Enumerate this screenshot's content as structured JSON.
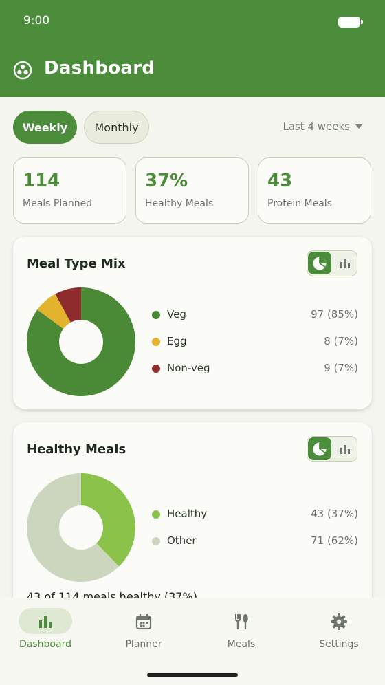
{
  "status_bar": {
    "time": "9:00"
  },
  "app": {
    "title": "Dashboard",
    "logo_icon": "three-dots-circle-icon"
  },
  "period_tabs": {
    "weekly": "Weekly",
    "monthly": "Monthly",
    "selected": "Weekly"
  },
  "range_select": {
    "label": "Last 4 weeks"
  },
  "stats": [
    {
      "value": "114",
      "label": "Meals Planned"
    },
    {
      "value": "37%",
      "label": "Healthy Meals"
    },
    {
      "value": "43",
      "label": "Protein Meals"
    }
  ],
  "colors": {
    "primary": "#4c8d3c",
    "veg": "#4a8a37",
    "egg": "#e3b32e",
    "non_veg": "#8e2b2c",
    "healthy": "#8bc34a",
    "other": "#ccd6bf"
  },
  "cards": {
    "meal_type": {
      "title": "Meal Type Mix",
      "view_toggle": {
        "pie_icon": "pie-chart-icon",
        "bar_icon": "bar-chart-icon",
        "selected": "pie"
      },
      "legend": [
        {
          "name": "Veg",
          "value": "97 (85%)"
        },
        {
          "name": "Egg",
          "value": "8 (7%)"
        },
        {
          "name": "Non-veg",
          "value": "9 (7%)"
        }
      ]
    },
    "healthy": {
      "title": "Healthy Meals",
      "view_toggle": {
        "pie_icon": "pie-chart-icon",
        "bar_icon": "bar-chart-icon",
        "selected": "pie"
      },
      "legend": [
        {
          "name": "Healthy",
          "value": "43 (37%)"
        },
        {
          "name": "Other",
          "value": "71 (62%)"
        }
      ],
      "note": "43 of 114 meals healthy (37%)"
    }
  },
  "chart_data": [
    {
      "type": "pie",
      "categories": [
        "Veg",
        "Egg",
        "Non-veg"
      ],
      "values": [
        97,
        8,
        9
      ]
    },
    {
      "type": "pie",
      "categories": [
        "Healthy",
        "Other"
      ],
      "values": [
        43,
        71
      ]
    }
  ],
  "bottom_nav": [
    {
      "label": "Dashboard",
      "icon": "bar-chart-icon",
      "active": true
    },
    {
      "label": "Planner",
      "icon": "calendar-icon",
      "active": false
    },
    {
      "label": "Meals",
      "icon": "fork-knife-icon",
      "active": false
    },
    {
      "label": "Settings",
      "icon": "gear-icon",
      "active": false
    }
  ]
}
